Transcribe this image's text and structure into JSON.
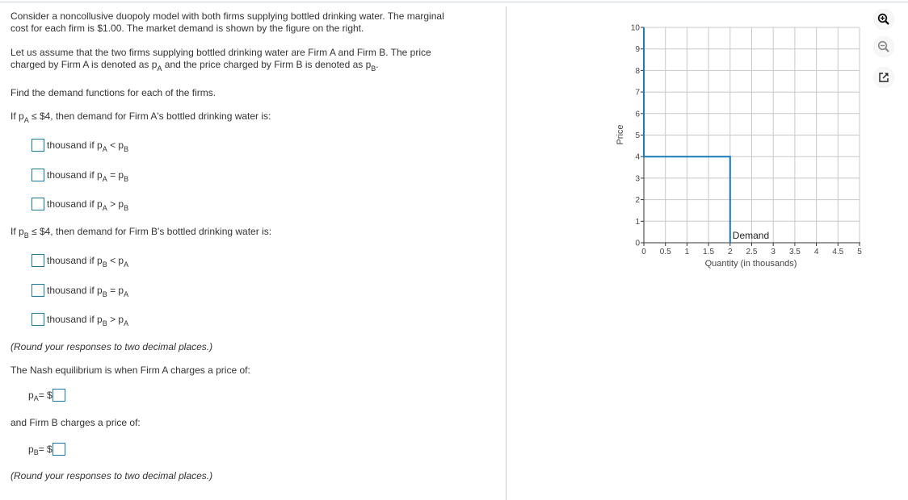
{
  "problem": {
    "intro_line1": "Consider a noncollusive duopoly model with both firms supplying bottled drinking water. The marginal",
    "intro_line2": "cost for each firm is $1.00. The market demand is shown by the figure on the right.",
    "assume_line1": "Let us assume that the two firms supplying bottled drinking water are Firm A and Firm B. The price",
    "assume_line2_a": "charged by Firm A is denoted as p",
    "assume_line2_b": " and the price charged by Firm B is denoted as p",
    "assume_line2_c": ".",
    "find": "Find the demand functions for each of the firms.",
    "firmA_cond_pre": "If p",
    "firmA_cond_post": " ≤ $4, then demand for Firm A's bottled drinking water is:",
    "firmB_cond_pre": "If p",
    "firmB_cond_post": " ≤ $4, then demand for Firm B's bottled drinking water is:",
    "sub_A": "A",
    "sub_B": "B",
    "p": "p",
    "thousand_if": "thousand if p",
    "firmA_rows": [
      {
        "op": " < p",
        "value": ""
      },
      {
        "op": " = p",
        "value": ""
      },
      {
        "op": " > p",
        "value": ""
      }
    ],
    "firmB_rows": [
      {
        "op": " < p",
        "value": ""
      },
      {
        "op": " = p",
        "value": ""
      },
      {
        "op": " > p",
        "value": ""
      }
    ],
    "round_note": "(Round your responses to two decimal places.)",
    "nash_A": "The Nash equilibrium is when Firm A charges a price of:",
    "eq_dollar": " = $",
    "pA_value": "",
    "nash_B": "and Firm B charges a price of:",
    "pB_value": "",
    "round_note2": "(Round your responses to two decimal places.)"
  },
  "toolbar": {
    "zoom_in": "zoom-in-icon",
    "zoom_out": "zoom-out-icon",
    "popout": "popout-icon"
  },
  "chart_data": {
    "type": "line",
    "title": "",
    "xlabel": "Quantity (in thousands)",
    "ylabel": "Price",
    "xlim": [
      0,
      5
    ],
    "ylim": [
      0,
      10
    ],
    "x_ticks": [
      "0",
      "0.5",
      "1",
      "1.5",
      "2",
      "2.5",
      "3",
      "3.5",
      "4",
      "4.5",
      "5"
    ],
    "y_ticks": [
      "0",
      "1",
      "2",
      "3",
      "4",
      "5",
      "6",
      "7",
      "8",
      "9",
      "10"
    ],
    "grid": true,
    "series": [
      {
        "name": "Demand",
        "color": "#1a7ab5",
        "points": [
          [
            0,
            10
          ],
          [
            0,
            4
          ],
          [
            2,
            4
          ],
          [
            2,
            0
          ]
        ]
      }
    ],
    "annotations": [
      {
        "text": "Demand",
        "x": 2,
        "y": 0
      }
    ]
  }
}
